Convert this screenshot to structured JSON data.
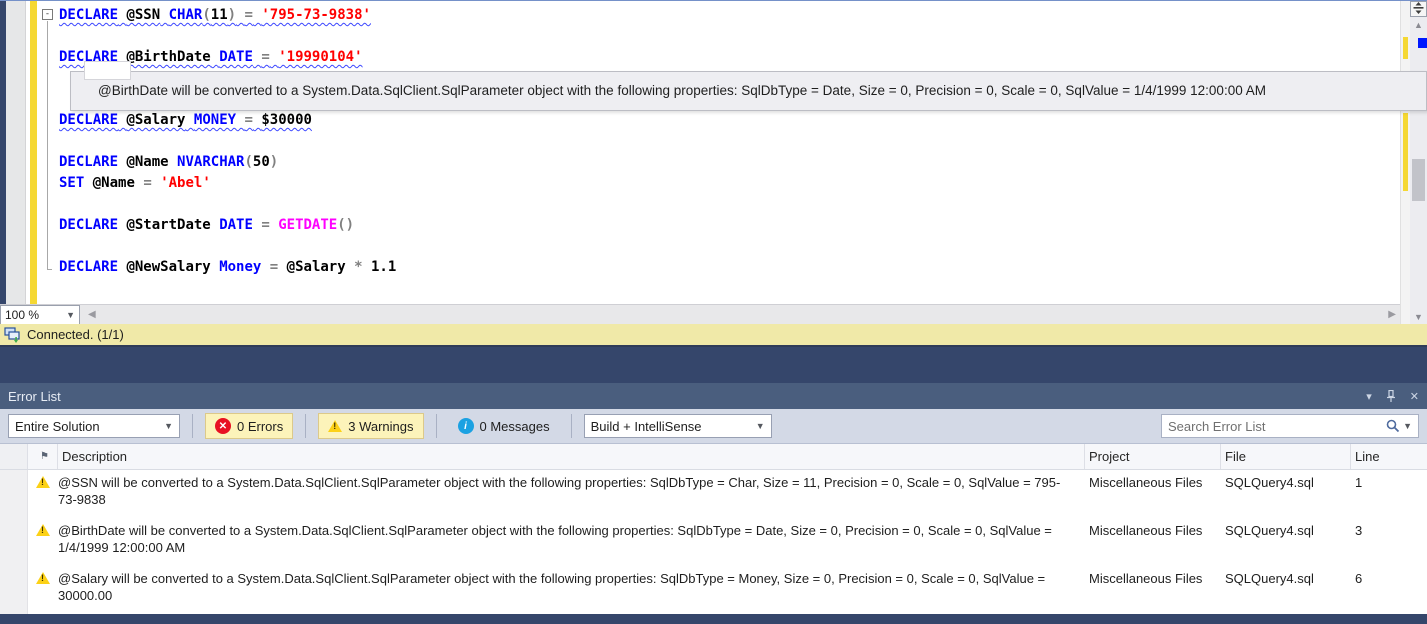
{
  "colors": {
    "title_bar": "#4a5e7e",
    "panel_gap": "#35466b",
    "status_bar": "#f0e9a8",
    "change_track": "#f5d833",
    "keyword": "#0000ff",
    "string": "#ff0000",
    "function": "#ff00ff",
    "operator": "#808080",
    "warning_toggle_bg": "#fcf3ba"
  },
  "editor": {
    "zoom_level": "100 %",
    "status_text": "Connected. (1/1)",
    "fold_marker": "-",
    "tooltip_text": "@BirthDate will be converted to a System.Data.SqlClient.SqlParameter object with the following properties: SqlDbType = Date, Size = 0, Precision = 0, Scale = 0, SqlValue = 1/4/1999 12:00:00 AM",
    "code_lines": [
      {
        "n": 1,
        "squiggle": true,
        "tokens": [
          [
            "DECLARE",
            "kw"
          ],
          [
            " ",
            "pl"
          ],
          [
            "@SSN",
            "pl"
          ],
          [
            " ",
            "pl"
          ],
          [
            "CHAR",
            "kw"
          ],
          [
            "(",
            "op"
          ],
          [
            "11",
            "pl"
          ],
          [
            ")",
            "op"
          ],
          [
            " ",
            "pl"
          ],
          [
            "=",
            "op"
          ],
          [
            " ",
            "pl"
          ],
          [
            "'795-73-9838'",
            "str"
          ]
        ]
      },
      {
        "n": 2,
        "squiggle": false,
        "tokens": []
      },
      {
        "n": 3,
        "squiggle": true,
        "tokens": [
          [
            "DECLARE",
            "kw"
          ],
          [
            " ",
            "pl"
          ],
          [
            "@BirthDate",
            "pl"
          ],
          [
            " ",
            "pl"
          ],
          [
            "DATE",
            "kw"
          ],
          [
            " ",
            "pl"
          ],
          [
            "=",
            "op"
          ],
          [
            " ",
            "pl"
          ],
          [
            "'19990104'",
            "str"
          ]
        ]
      },
      {
        "n": 4,
        "squiggle": false,
        "tokens": []
      },
      {
        "n": 5,
        "squiggle": false,
        "tokens": []
      },
      {
        "n": 6,
        "squiggle": true,
        "tokens": [
          [
            "DECLARE",
            "kw"
          ],
          [
            " ",
            "pl"
          ],
          [
            "@Salary",
            "pl"
          ],
          [
            " ",
            "pl"
          ],
          [
            "MONEY",
            "kw"
          ],
          [
            " ",
            "pl"
          ],
          [
            "=",
            "op"
          ],
          [
            " ",
            "pl"
          ],
          [
            "$30000",
            "pl"
          ]
        ]
      },
      {
        "n": 7,
        "squiggle": false,
        "tokens": []
      },
      {
        "n": 8,
        "squiggle": false,
        "tokens": [
          [
            "DECLARE",
            "kw"
          ],
          [
            " ",
            "pl"
          ],
          [
            "@Name",
            "pl"
          ],
          [
            " ",
            "pl"
          ],
          [
            "NVARCHAR",
            "kw"
          ],
          [
            "(",
            "op"
          ],
          [
            "50",
            "pl"
          ],
          [
            ")",
            "op"
          ]
        ]
      },
      {
        "n": 9,
        "squiggle": false,
        "tokens": [
          [
            "SET",
            "kw"
          ],
          [
            " ",
            "pl"
          ],
          [
            "@Name",
            "pl"
          ],
          [
            " ",
            "pl"
          ],
          [
            "=",
            "op"
          ],
          [
            " ",
            "pl"
          ],
          [
            "'Abel'",
            "str"
          ]
        ]
      },
      {
        "n": 10,
        "squiggle": false,
        "tokens": []
      },
      {
        "n": 11,
        "squiggle": false,
        "tokens": [
          [
            "DECLARE",
            "kw"
          ],
          [
            " ",
            "pl"
          ],
          [
            "@StartDate",
            "pl"
          ],
          [
            " ",
            "pl"
          ],
          [
            "DATE",
            "kw"
          ],
          [
            " ",
            "pl"
          ],
          [
            "=",
            "op"
          ],
          [
            " ",
            "pl"
          ],
          [
            "GETDATE",
            "fn"
          ],
          [
            "(",
            "op"
          ],
          [
            ")",
            "op"
          ]
        ]
      },
      {
        "n": 12,
        "squiggle": false,
        "tokens": []
      },
      {
        "n": 13,
        "squiggle": false,
        "tokens": [
          [
            "DECLARE",
            "kw"
          ],
          [
            " ",
            "pl"
          ],
          [
            "@NewSalary",
            "pl"
          ],
          [
            " ",
            "pl"
          ],
          [
            "Money",
            "kw"
          ],
          [
            " ",
            "pl"
          ],
          [
            "=",
            "op"
          ],
          [
            " ",
            "pl"
          ],
          [
            "@Salary",
            "pl"
          ],
          [
            " ",
            "pl"
          ],
          [
            "*",
            "op"
          ],
          [
            " ",
            "pl"
          ],
          [
            "1.1",
            "pl"
          ]
        ]
      }
    ]
  },
  "error_list": {
    "title": "Error List",
    "toolbar": {
      "scope_dropdown": "Entire Solution",
      "errors_label": "0 Errors",
      "warnings_label": "3 Warnings",
      "messages_label": "0 Messages",
      "build_dropdown": "Build + IntelliSense",
      "search_placeholder": "Search Error List"
    },
    "columns": [
      "Description",
      "Project",
      "File",
      "Line"
    ],
    "rows": [
      {
        "severity": "warning",
        "description": "@SSN will be converted to a System.Data.SqlClient.SqlParameter object with the following properties: SqlDbType = Char, Size = 11, Precision = 0, Scale = 0, SqlValue = 795-73-9838",
        "project": "Miscellaneous Files",
        "file": "SQLQuery4.sql",
        "line": "1"
      },
      {
        "severity": "warning",
        "description": "@BirthDate will be converted to a System.Data.SqlClient.SqlParameter object with the following properties: SqlDbType = Date, Size = 0, Precision = 0, Scale = 0, SqlValue = 1/4/1999 12:00:00 AM",
        "project": "Miscellaneous Files",
        "file": "SQLQuery4.sql",
        "line": "3"
      },
      {
        "severity": "warning",
        "description": "@Salary will be converted to a System.Data.SqlClient.SqlParameter object with the following properties: SqlDbType = Money, Size = 0, Precision = 0, Scale = 0, SqlValue = 30000.00",
        "project": "Miscellaneous Files",
        "file": "SQLQuery4.sql",
        "line": "6"
      }
    ]
  }
}
